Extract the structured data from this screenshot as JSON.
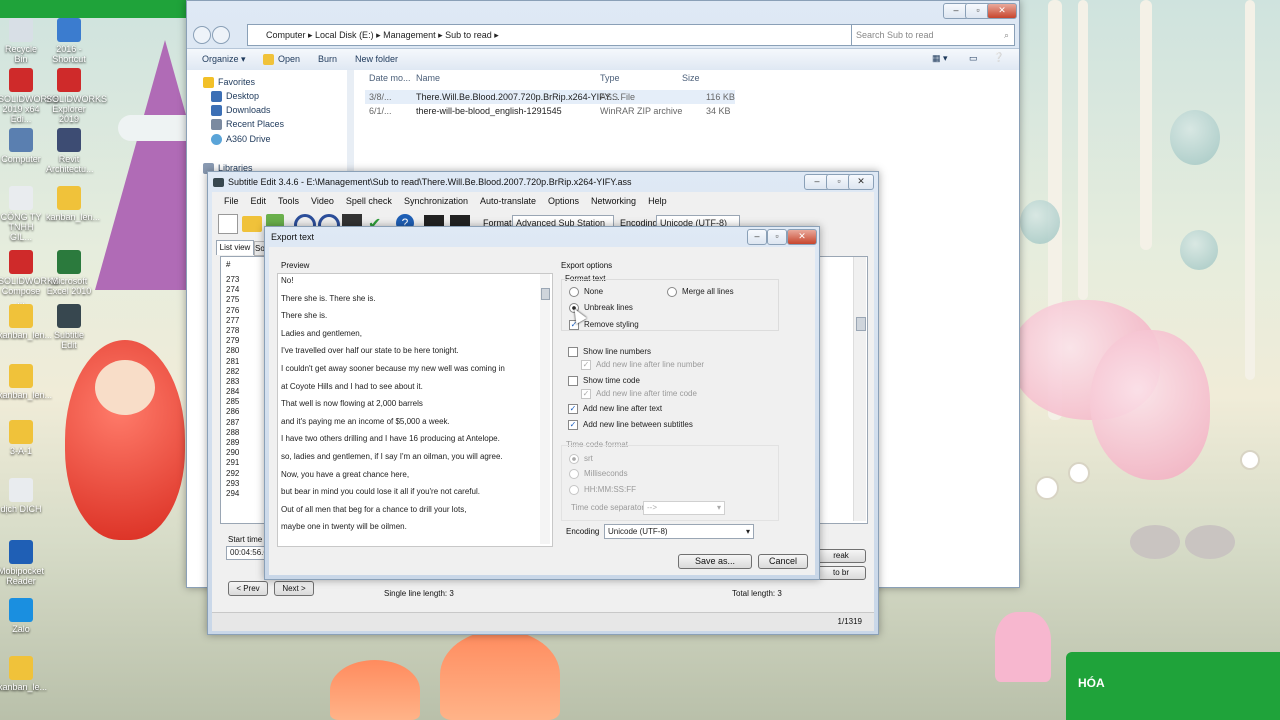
{
  "desktop": {
    "icons": [
      {
        "label": "Recycle Bin",
        "color": "#d8dfe6"
      },
      {
        "label": "2016 - Shortcut",
        "color": "#3b7ccf"
      },
      {
        "label": "SOLIDWORKS 2019 x64 Edi...",
        "color": "#cf2a2a"
      },
      {
        "label": "SOLIDWORKS Explorer 2019",
        "color": "#cf2a2a"
      },
      {
        "label": "Computer",
        "color": "#5a7fb0"
      },
      {
        "label": "Revit Architectu...",
        "color": "#3d4c73"
      },
      {
        "label": "CÔNG TY TNHH GIL...",
        "color": "#e9ecef"
      },
      {
        "label": "kanban_len...",
        "color": "#f0c23a"
      },
      {
        "label": "SOLIDWORKS Compose ...",
        "color": "#cf2a2a"
      },
      {
        "label": "Microsoft Excel 2010",
        "color": "#2b7a3d"
      },
      {
        "label": "kanban_len...",
        "color": "#f0c23a"
      },
      {
        "label": "Subtitle Edit",
        "color": "#37474f"
      },
      {
        "label": "kanban_len...",
        "color": "#f0c23a"
      },
      {
        "label": "3-A-1",
        "color": "#f0c23a"
      },
      {
        "label": "dịch DICH",
        "color": "#e9ecef"
      },
      {
        "label": "Mobipocket Reader",
        "color": "#1f5fb5"
      },
      {
        "label": "Zalo",
        "color": "#1a8fe0"
      },
      {
        "label": "kanban_le...",
        "color": "#f0c23a"
      }
    ],
    "corner_text": "HÓA"
  },
  "explorer": {
    "breadcrumb": [
      "Computer",
      "Local Disk (E:)",
      "Management",
      "Sub to read"
    ],
    "search_placeholder": "Search Sub to read",
    "toolbar": {
      "organize": "Organize ▾",
      "open": "Open",
      "burn": "Burn",
      "new_folder": "New folder"
    },
    "nav": {
      "favorites": "Favorites",
      "desktop": "Desktop",
      "downloads": "Downloads",
      "recent": "Recent Places",
      "a360": "A360 Drive",
      "libraries": "Libraries"
    },
    "columns": {
      "date": "Date mo...",
      "name": "Name",
      "type": "Type",
      "size": "Size"
    },
    "files": [
      {
        "date": "3/8/...",
        "name": "There.Will.Be.Blood.2007.720p.BrRip.x264-YIFY....",
        "type": "ASS File",
        "size": "116 KB"
      },
      {
        "date": "6/1/...",
        "name": "there-will-be-blood_english-1291545",
        "type": "WinRAR ZIP archive",
        "size": "34 KB"
      }
    ]
  },
  "subtitle_edit": {
    "title": "Subtitle Edit 3.4.6 - E:\\Management\\Sub to read\\There.Will.Be.Blood.2007.720p.BrRip.x264-YIFY.ass",
    "menu": [
      "File",
      "Edit",
      "Tools",
      "Video",
      "Spell check",
      "Synchronization",
      "Auto-translate",
      "Options",
      "Networking",
      "Help"
    ],
    "format_label": "Format",
    "format_value": "Advanced Sub Station A",
    "encoding_label": "Encoding",
    "encoding_value": "Unicode (UTF-8)",
    "tab_list": "List view",
    "tab_source": "So",
    "num_header": "#",
    "row_numbers": [
      "273",
      "274",
      "275",
      "276",
      "277",
      "278",
      "279",
      "280",
      "281",
      "282",
      "283",
      "284",
      "285",
      "286",
      "287",
      "288",
      "289",
      "290",
      "291",
      "292",
      "293",
      "294"
    ],
    "start_time_label": "Start time",
    "start_time_value": "00:04:56.6",
    "prev": "< Prev",
    "next": "Next >",
    "single_line": "Single line length: 3",
    "total_length": "Total length: 3",
    "break_btn": "reak",
    "br_btn": "to br",
    "counter": "1/1319"
  },
  "export": {
    "title": "Export text",
    "preview_label": "Preview",
    "preview_lines": [
      "No!",
      "There she is.  There she is.",
      "There she is.",
      "Ladies and gentlemen,",
      "I've travelled over half our state to be here tonight.",
      "I couldn't get away sooner because my new well was coming in",
      "at Coyote Hills and I had to see about it.",
      "That well is now flowing at 2,000 barrels",
      "and it's paying me an income of $5,000 a week.",
      "I have two others drilling and I have 16 producing at Antelope.",
      "so, ladies and gentlemen, if I say I'm an oilman, you will agree.",
      "Now, you have a great chance here,",
      "but bear in mind you could lose it all if you're not careful.",
      "Out of all men that beg for a chance to drill your lots,",
      "maybe one in twenty will be oilmen."
    ],
    "export_options": "Export options",
    "format_text": "Format text",
    "none": "None",
    "merge_all": "Merge all lines",
    "unbreak": "Unbreak lines",
    "remove_styling": "Remove styling",
    "show_line_numbers": "Show line numbers",
    "add_after_line_number": "Add new line after line number",
    "show_time_code": "Show time code",
    "add_after_time_code": "Add new line after time code",
    "add_after_text": "Add new line after text",
    "add_between": "Add new line between subtitles",
    "timecode_format": "Time code format",
    "srt": "srt",
    "ms": "Milliseconds",
    "hhmmssff": "HH:MM:SS:FF",
    "separator_label": "Time code separator",
    "separator_value": "-->",
    "encoding_label": "Encoding",
    "encoding_value": "Unicode (UTF-8)",
    "save_as": "Save as...",
    "cancel": "Cancel"
  }
}
